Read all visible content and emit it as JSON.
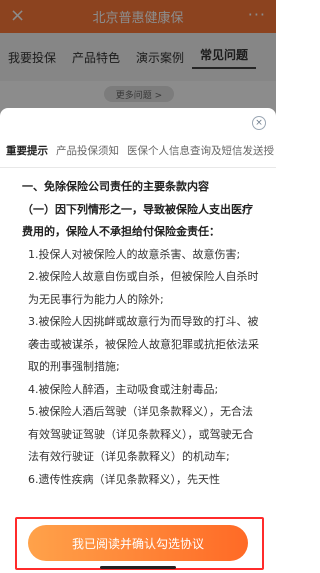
{
  "header": {
    "title": "北京普惠健康保",
    "close_icon": "×",
    "more_icon": "···"
  },
  "tabs": [
    "我要投保",
    "产品特色",
    "演示案例",
    "常见问题"
  ],
  "more_questions": "更多问题 >",
  "sheet": {
    "close_icon": "×",
    "tabs": [
      "重要提示",
      "产品投保须知",
      "医保个人信息查询及短信发送授"
    ],
    "content": [
      {
        "type": "h1",
        "text": "一、免除保险公司责任的主要条款内容"
      },
      {
        "type": "h2",
        "text": "（一）因下列情形之一，导致被保险人支出医疗费用的，保险人不承担给付保险金责任："
      },
      {
        "type": "item",
        "text": "1.投保人对被保险人的故意杀害、故意伤害;"
      },
      {
        "type": "item",
        "text": "2.被保险人故意自伤或自杀，但被保险人自杀时为无民事行为能力人的除外;"
      },
      {
        "type": "item",
        "text": "3.被保险人因挑衅或故意行为而导致的打斗、被袭击或被谋杀，被保险人故意犯罪或抗拒依法采取的刑事强制措施;"
      },
      {
        "type": "item",
        "text": "4.被保险人醉酒，主动吸食或注射毒品;"
      },
      {
        "type": "item",
        "text": "5.被保险人酒后驾驶（详见条款释义），无合法有效驾驶证驾驶（详见条款释义），或驾驶无合法有效行驶证（详见条款释义）的机动车;"
      },
      {
        "type": "item",
        "text": "6.遗传性疾病（详见条款释义），先天性"
      }
    ],
    "confirm_button": "我已阅读并确认勾选协议"
  },
  "colors": {
    "accent": "#ff7a3a",
    "highlight": "#ff2b2b"
  }
}
